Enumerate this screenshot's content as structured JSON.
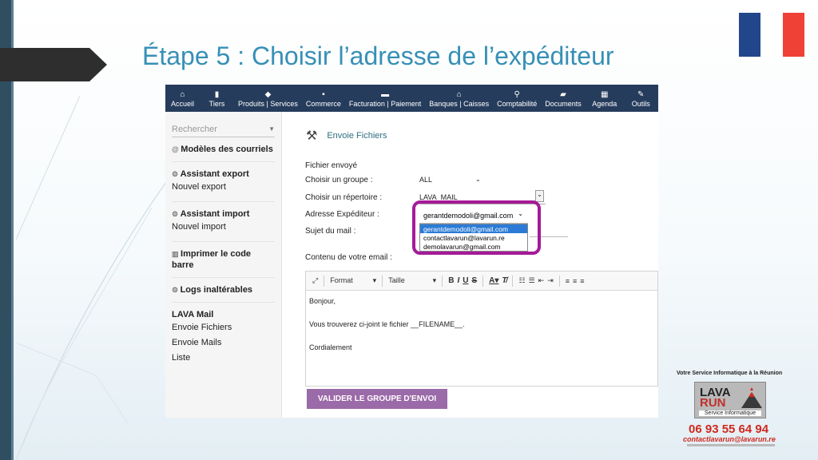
{
  "slide": {
    "title": "Étape 5 : Choisir l’adresse de l’expéditeur",
    "flag_colors": [
      "#21468b",
      "#ffffff",
      "#ef4135"
    ]
  },
  "app": {
    "nav": [
      {
        "icon": "home-icon",
        "glyph": "⌂",
        "label": "Accueil"
      },
      {
        "icon": "building-icon",
        "glyph": "▮",
        "label": "Tiers"
      },
      {
        "icon": "cube-icon",
        "glyph": "◆",
        "label": "Produits | Services"
      },
      {
        "icon": "briefcase-icon",
        "glyph": "▪",
        "label": "Commerce"
      },
      {
        "icon": "money-icon",
        "glyph": "▬",
        "label": "Facturation | Paiement"
      },
      {
        "icon": "bank-icon",
        "glyph": "⌂",
        "label": "Banques | Caisses"
      },
      {
        "icon": "search-icon",
        "glyph": "⚲",
        "label": "Comptabilité"
      },
      {
        "icon": "folder-icon",
        "glyph": "▰",
        "label": "Documents"
      },
      {
        "icon": "calendar-icon",
        "glyph": "▦",
        "label": "Agenda"
      },
      {
        "icon": "wrench-icon",
        "glyph": "✎",
        "label": "Outils"
      }
    ],
    "sidebar": {
      "search_placeholder": "Rechercher",
      "sections": [
        {
          "title": "Modèles des courriels",
          "links": []
        },
        {
          "title": "Assistant export",
          "links": [
            "Nouvel export"
          ]
        },
        {
          "title": "Assistant import",
          "links": [
            "Nouvel import"
          ]
        },
        {
          "title": "Imprimer le code barre",
          "links": []
        },
        {
          "title": "Logs inaltérables",
          "links": []
        },
        {
          "title": "LAVA Mail",
          "links": [
            "Envoie Fichiers",
            "Envoie Mails",
            "Liste"
          ]
        }
      ]
    },
    "panel": {
      "title": "Envoie Fichiers",
      "fichier_label": "Fichier envoyé",
      "groupe_label": "Choisir un groupe :",
      "groupe_value": "ALL",
      "repertoire_label": "Choisir un répertoire :",
      "repertoire_value": "LAVA_MAIL",
      "expediteur_label": "Adresse Expéditeur :",
      "expediteur_value": "gerantdemodoli@gmail.com",
      "expediteur_options": [
        "gerantdemodoli@gmail.com",
        "contactlavarun@lavarun.re",
        "demolavarun@gmail.com"
      ],
      "sujet_label": "Sujet du mail :",
      "contenu_label": "Contenu de votre email :",
      "editor_format": "Format",
      "editor_size": "Taille",
      "editor_lines": [
        "Bonjour,",
        "Vous trouverez ci-joint le fichier __FILENAME__.",
        "Cordialement"
      ],
      "submit_label": "VALIDER LE GROUPE D'ENVOI"
    }
  },
  "branding": {
    "service": "Votre Service Informatique à la Réunion",
    "logo_line1": "LAVA",
    "logo_line2": "RUN",
    "logo_sub": "Service Informatique",
    "phone": "06 93 55 64 94",
    "email": "contactlavarun@lavarun.re"
  }
}
